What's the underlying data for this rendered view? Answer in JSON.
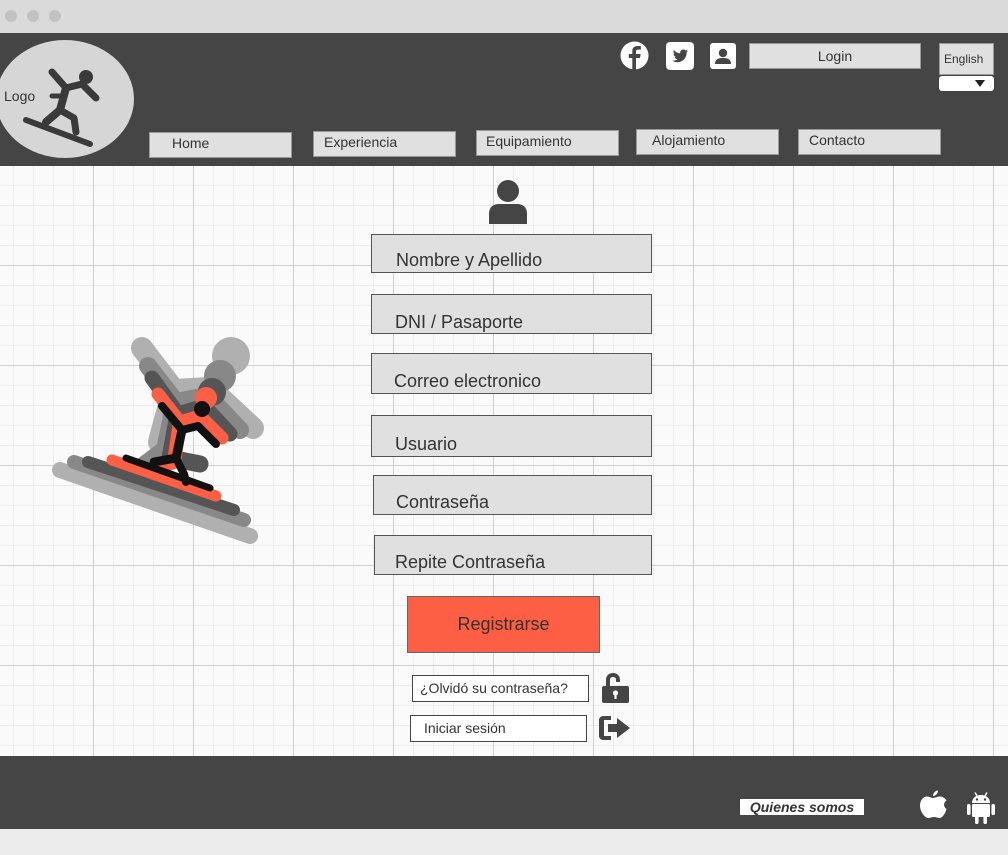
{
  "header": {
    "logo_text": "Logo",
    "login_label": "Login",
    "language": "English",
    "nav": [
      {
        "label": "Home"
      },
      {
        "label": "Experiencia"
      },
      {
        "label": "Equipamiento"
      },
      {
        "label": "Alojamiento"
      },
      {
        "label": "Contacto"
      }
    ],
    "social_icons": [
      "facebook-icon",
      "twitter-icon",
      "contact-card-icon"
    ]
  },
  "form": {
    "user_icon": "user-icon",
    "fields": [
      {
        "placeholder": "Nombre y Apellido"
      },
      {
        "placeholder": "DNI / Pasaporte"
      },
      {
        "placeholder": "Correo electronico"
      },
      {
        "placeholder": "Usuario"
      },
      {
        "placeholder": "Contraseña"
      },
      {
        "placeholder": "Repite Contraseña"
      }
    ],
    "register_label": "Registrarse",
    "forgot_label": "¿Olvidó su contraseña?",
    "signin_label": "Iniciar sesión"
  },
  "footer": {
    "about_label": "Quienes somos",
    "store_icons": [
      "apple-icon",
      "android-icon"
    ]
  },
  "colors": {
    "header_bg": "#454545",
    "accent": "#fd5f45",
    "field_bg": "#e0e0e0"
  }
}
